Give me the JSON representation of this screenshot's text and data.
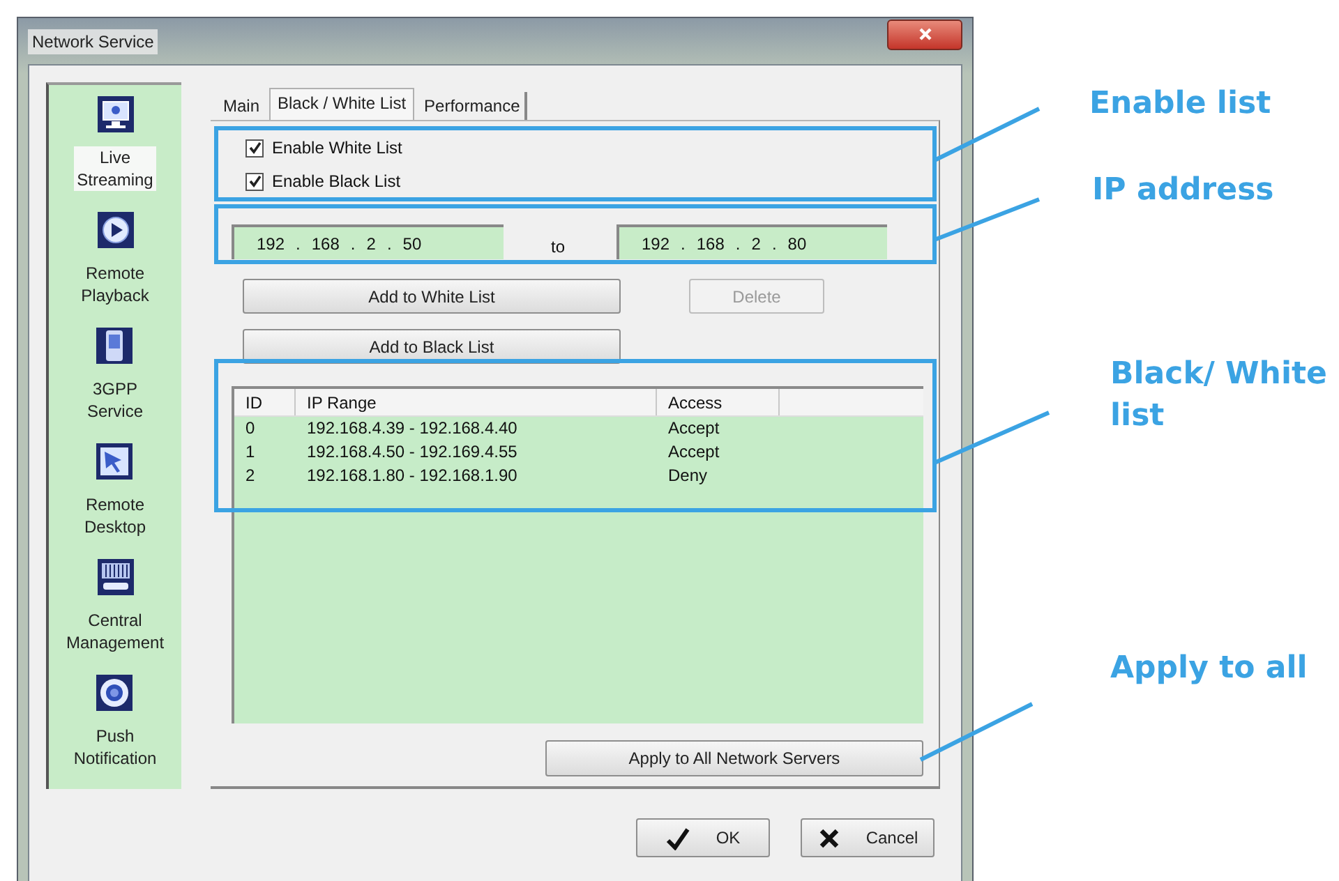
{
  "window": {
    "title": "Network Service"
  },
  "sidebar": {
    "items": [
      {
        "label": "Live Streaming",
        "selected": true
      },
      {
        "label": "Remote Playback",
        "selected": false
      },
      {
        "label": "3GPP Service",
        "selected": false
      },
      {
        "label": "Remote Desktop",
        "selected": false
      },
      {
        "label": "Central Management",
        "selected": false
      },
      {
        "label": "Push Notification",
        "selected": false
      }
    ]
  },
  "tabs": [
    {
      "label": "Main",
      "selected": false
    },
    {
      "label": "Black / White List",
      "selected": true
    },
    {
      "label": "Performance",
      "selected": false
    }
  ],
  "checkboxes": [
    {
      "label": "Enable White List",
      "checked": true
    },
    {
      "label": "Enable Black List",
      "checked": true
    }
  ],
  "ip_range": {
    "from": [
      "192",
      "168",
      "2",
      "50"
    ],
    "separator": "to",
    "to": [
      "192",
      "168",
      "2",
      "80"
    ],
    "octet_separator": "."
  },
  "buttons": [
    {
      "label": "Add to White List",
      "disabled": false
    },
    {
      "label": "Delete",
      "disabled": true
    },
    {
      "label": "Add to Black List",
      "disabled": false
    }
  ],
  "table": {
    "columns": [
      "ID",
      "IP Range",
      "Access"
    ],
    "rows": [
      [
        "0",
        "192.168.4.39 - 192.168.4.40",
        "Accept"
      ],
      [
        "1",
        "192.168.4.50 - 192.169.4.55",
        "Accept"
      ],
      [
        "2",
        "192.168.1.80 - 192.168.1.90",
        "Deny"
      ]
    ]
  },
  "apply_button": {
    "label": "Apply to All Network Servers"
  },
  "footer_buttons": [
    {
      "label": "OK",
      "kind": "ok"
    },
    {
      "label": "Cancel",
      "kind": "cancel"
    }
  ],
  "annotations": [
    {
      "label": "Enable list"
    },
    {
      "label": "IP address"
    },
    {
      "label": "Black/ White list"
    },
    {
      "label": "Apply to all"
    }
  ]
}
